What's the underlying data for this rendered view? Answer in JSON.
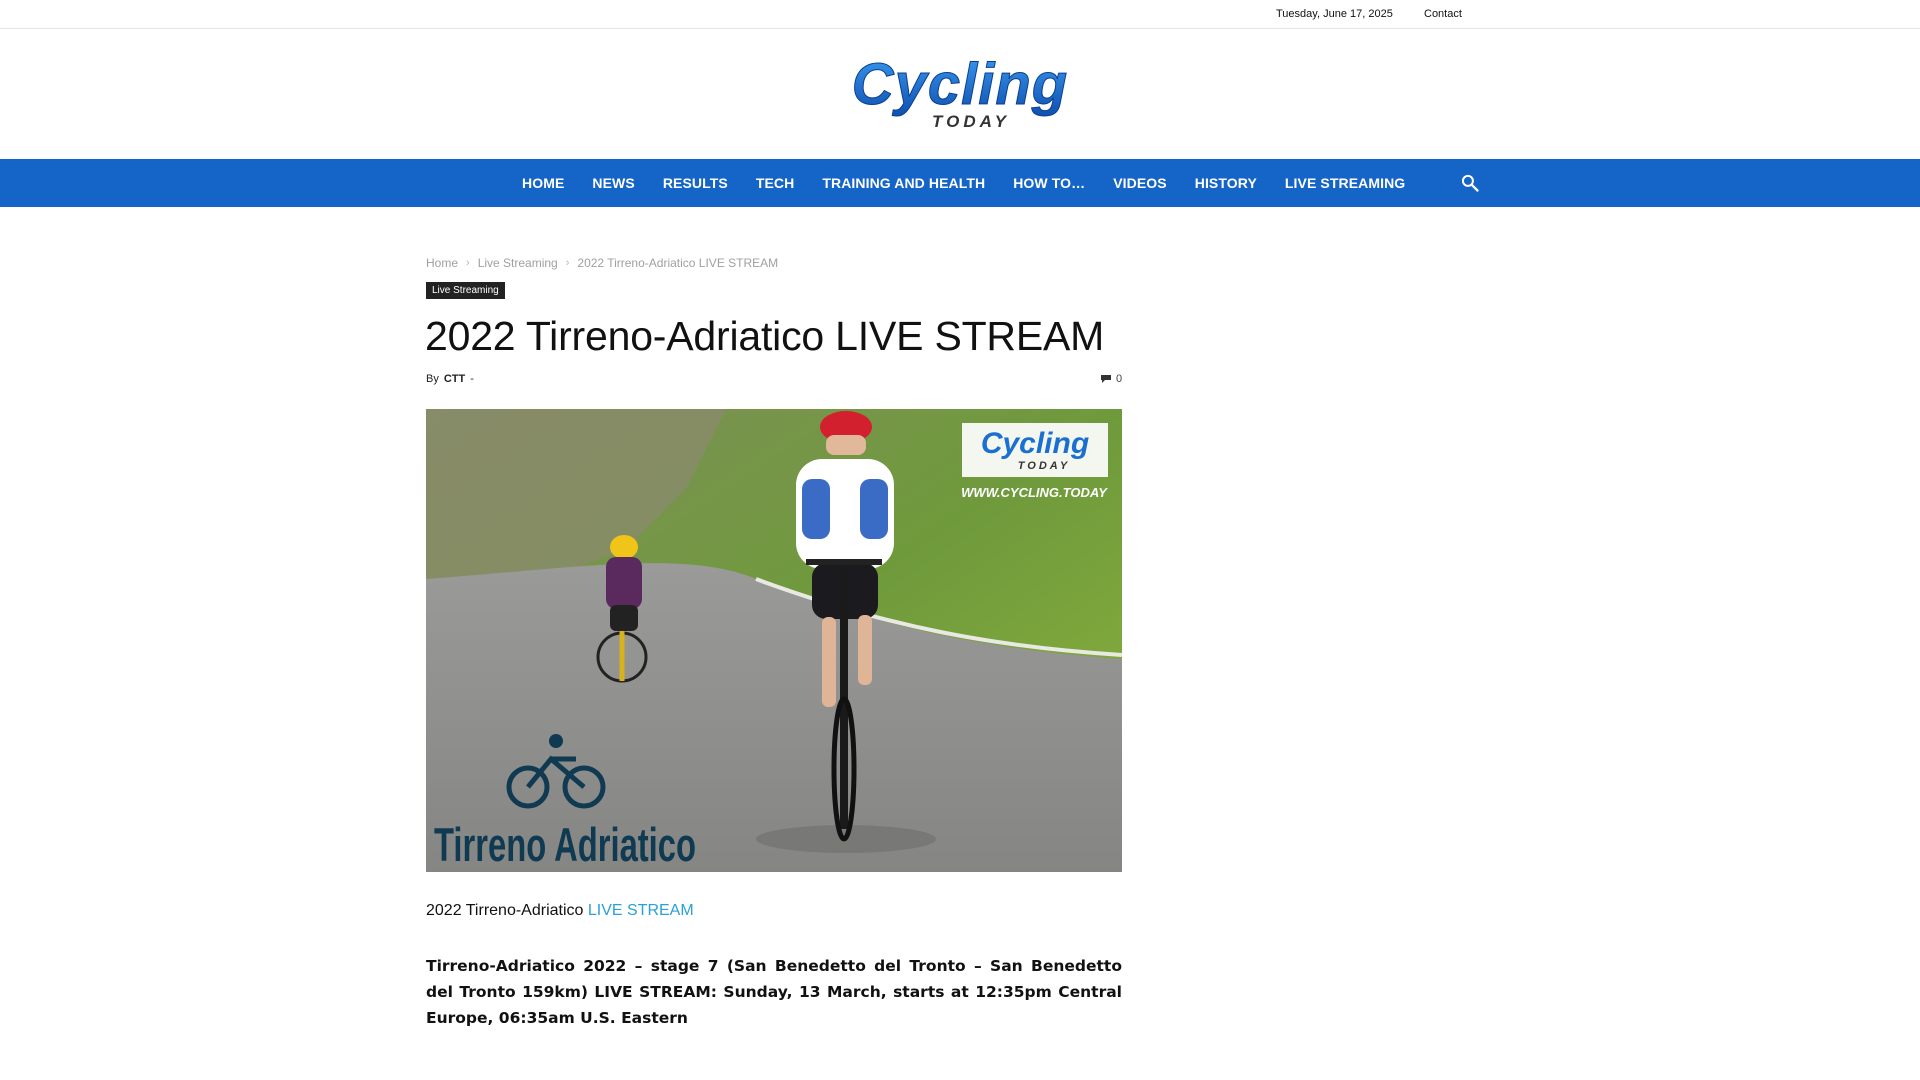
{
  "topbar": {
    "date": "Tuesday, June 17, 2025",
    "contact": "Contact"
  },
  "logo": {
    "word": "Cycling",
    "sub": "TODAY",
    "primary_color": "#1a6fd1"
  },
  "nav": {
    "items": [
      {
        "label": "HOME"
      },
      {
        "label": "NEWS"
      },
      {
        "label": "RESULTS"
      },
      {
        "label": "TECH"
      },
      {
        "label": "TRAINING AND HEALTH"
      },
      {
        "label": "HOW TO…"
      },
      {
        "label": "VIDEOS"
      },
      {
        "label": "HISTORY"
      },
      {
        "label": "LIVE STREAMING"
      }
    ],
    "search_icon": "search-icon",
    "background": "#1565c8"
  },
  "breadcrumb": {
    "home": "Home",
    "category": "Live Streaming",
    "current": "2022 Tirreno-Adriatico LIVE STREAM"
  },
  "article": {
    "category_badge": "Live Streaming",
    "title": "2022 Tirreno-Adriatico LIVE STREAM",
    "by": "By",
    "author": "CTT",
    "dash": "-",
    "comment_count": "0",
    "intro_text": "2022 Tirreno-Adriatico ",
    "intro_link": "LIVE STREAM",
    "body": "Tirreno-Adriatico 2022 – stage 7 (San Benedetto del Tronto – San Benedetto del Tronto 159km) LIVE STREAM: Sunday, 13 March, starts at 12:35pm Central Europe, 06:35am U.S. Eastern"
  },
  "hero": {
    "badge_word": "Cycling",
    "badge_sub": "TODAY",
    "badge_url": "WWW.CYCLING.TODAY",
    "race_logo": "Tirreno Adriatico"
  }
}
